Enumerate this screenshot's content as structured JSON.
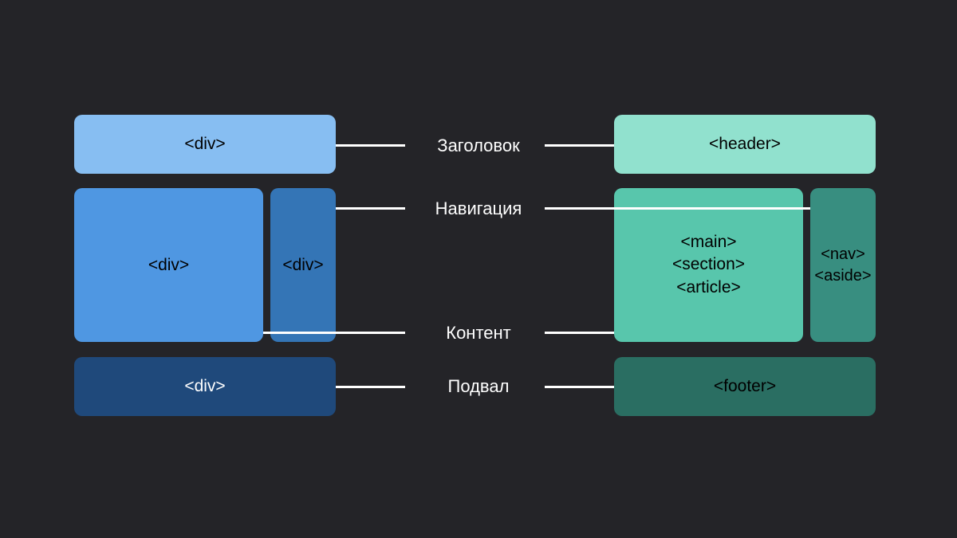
{
  "left": {
    "header": "<div>",
    "content": "<div>",
    "nav": "<div>",
    "footer": "<div>"
  },
  "right": {
    "header": "<header>",
    "content_line1": "<main>",
    "content_line2": "<section>",
    "content_line3": "<article>",
    "nav_line1": "<nav>",
    "nav_line2": "<aside>",
    "footer": "<footer>"
  },
  "labels": {
    "header": "Заголовок",
    "nav": "Навигация",
    "content": "Контент",
    "footer": "Подвал"
  },
  "colors": {
    "background": "#242428",
    "left_header": "#87bef2",
    "left_content": "#4f97e2",
    "left_nav": "#3475b6",
    "left_footer": "#1f497b",
    "right_header": "#91e1ce",
    "right_content": "#58c6ac",
    "right_nav": "#388e80",
    "right_footer": "#2a6e62"
  }
}
